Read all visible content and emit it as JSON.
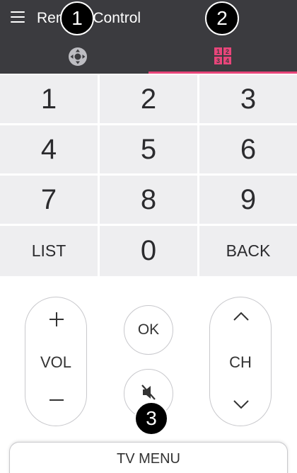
{
  "colors": {
    "header_bg": "#3b3b3f",
    "accent": "#e8457a",
    "key_bg": "#eeeef0"
  },
  "header": {
    "title": "Remote Control",
    "menu_icon": "hamburger-menu-icon",
    "tabs": [
      {
        "name": "dpad",
        "icon": "dpad-icon",
        "selected": false
      },
      {
        "name": "number-pad",
        "icon": "number-pad-icon",
        "selected": true,
        "icon_digits": [
          "1",
          "2",
          "3",
          "4"
        ]
      }
    ]
  },
  "callouts": [
    "1",
    "2",
    "3"
  ],
  "keypad": {
    "rows": [
      [
        "1",
        "2",
        "3"
      ],
      [
        "4",
        "5",
        "6"
      ],
      [
        "7",
        "8",
        "9"
      ],
      [
        "LIST",
        "0",
        "BACK"
      ]
    ]
  },
  "controls": {
    "vol": {
      "label": "VOL",
      "up_icon": "plus-icon",
      "down_icon": "minus-icon"
    },
    "ok": {
      "label": "OK"
    },
    "mute": {
      "icon": "mute-icon"
    },
    "ch": {
      "label": "CH",
      "up_icon": "chevron-up-icon",
      "down_icon": "chevron-down-icon"
    }
  },
  "tv_menu": {
    "label": "TV MENU"
  }
}
